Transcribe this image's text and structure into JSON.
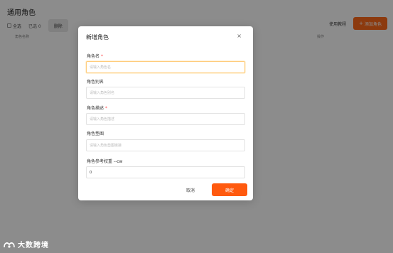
{
  "page": {
    "title": "通用角色"
  },
  "toolbar": {
    "select_all_label": "全选",
    "selected_count": "已选 0",
    "delete_label": "删除",
    "tutorial_label": "使用教程",
    "add_role_label": "添加角色",
    "add_role_plus": "+"
  },
  "table": {
    "columns": [
      "角色名称",
      "操作"
    ]
  },
  "modal": {
    "title": "新增角色",
    "close_glyph": "×",
    "fields": [
      {
        "label": "角色名",
        "required": "*",
        "placeholder": "请输入角色名",
        "value": ""
      },
      {
        "label": "角色别名",
        "required": "",
        "placeholder": "请输入角色别名",
        "value": ""
      },
      {
        "label": "角色描述",
        "required": "*",
        "placeholder": "请输入角色描述",
        "value": ""
      },
      {
        "label": "角色垫图",
        "required": "",
        "placeholder": "请输入角色垫图链接",
        "value": ""
      },
      {
        "label": "角色参考权重 --cw",
        "required": "",
        "placeholder": "",
        "value": "0"
      }
    ],
    "cancel_label": "取消",
    "confirm_label": "确定"
  },
  "watermark": {
    "text": "大数跨境"
  },
  "colors": {
    "accent": "#ff6a1a",
    "confirm": "#ff5a0f",
    "required": "#ff4d4f",
    "overlay": "rgba(0,0,0,0.45)"
  }
}
